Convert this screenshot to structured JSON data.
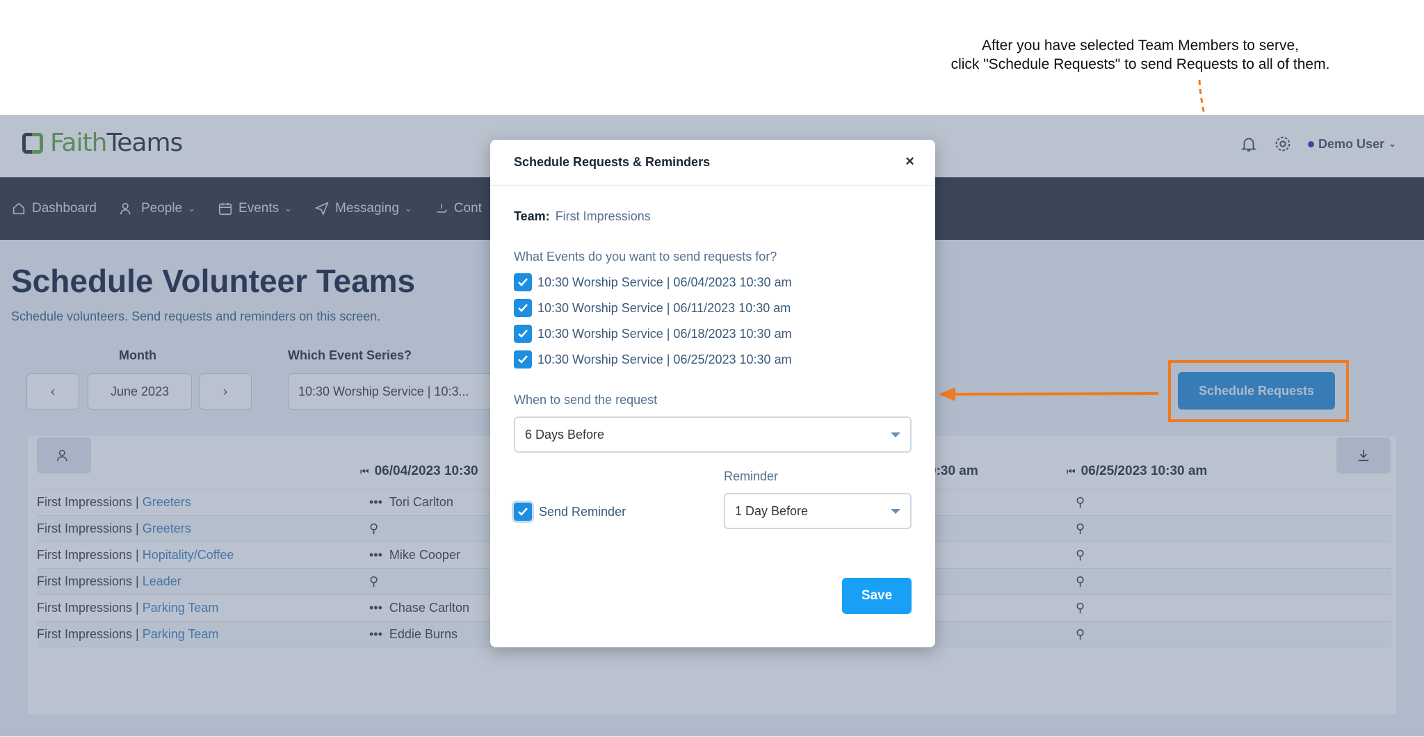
{
  "annotation": {
    "line1": "After you have selected Team Members to serve,",
    "line2": "click \"Schedule Requests\" to send Requests to all of them."
  },
  "app": {
    "logo_faith": "Faith",
    "logo_teams": "Teams",
    "user_name": "Demo User",
    "nav": [
      {
        "label": "Dashboard",
        "icon": "home-icon"
      },
      {
        "label": "People",
        "icon": "people-icon"
      },
      {
        "label": "Events",
        "icon": "calendar-icon"
      },
      {
        "label": "Messaging",
        "icon": "send-icon"
      },
      {
        "label": "Cont",
        "icon": "hand-icon"
      }
    ]
  },
  "page": {
    "title": "Schedule Volunteer Teams",
    "subtitle": "Schedule volunteers. Send requests and reminders on this screen.",
    "month_label": "Month",
    "month_value": "June 2023",
    "series_label": "Which Event Series?",
    "series_value": "10:30 Worship Service | 10:3...",
    "schedule_button": "Schedule Requests"
  },
  "table": {
    "col1_header": "06/04/2023 10:30",
    "col_mid_header": "0:30 am",
    "col4_header": "06/25/2023 10:30 am",
    "rows": [
      {
        "team": "First Impressions | ",
        "role": "Greeters",
        "person": "Tori Carlton"
      },
      {
        "team": "First Impressions | ",
        "role": "Greeters",
        "person": ""
      },
      {
        "team": "First Impressions | ",
        "role": "Hopitality/Coffee",
        "person": "Mike Cooper"
      },
      {
        "team": "First Impressions | ",
        "role": "Leader",
        "person": ""
      },
      {
        "team": "First Impressions | ",
        "role": "Parking Team",
        "person": "Chase Carlton"
      },
      {
        "team": "First Impressions | ",
        "role": "Parking Team",
        "person": "Eddie Burns"
      }
    ]
  },
  "modal": {
    "title": "Schedule Requests & Reminders",
    "close": "×",
    "team_label": "Team:",
    "team_value": "First Impressions",
    "events_question": "What Events do you want to send requests for?",
    "events": [
      "10:30 Worship Service | 06/04/2023 10:30 am",
      "10:30 Worship Service | 06/11/2023 10:30 am",
      "10:30 Worship Service | 06/18/2023 10:30 am",
      "10:30 Worship Service | 06/25/2023 10:30 am"
    ],
    "when_label": "When to send the request",
    "when_value": "6 Days Before",
    "send_reminder_label": "Send Reminder",
    "reminder_label": "Reminder",
    "reminder_value": "1 Day Before",
    "save_label": "Save"
  },
  "colors": {
    "accent_blue": "#17a0f5",
    "highlight_orange": "#f07a1f",
    "nav_bg": "#252a33"
  }
}
